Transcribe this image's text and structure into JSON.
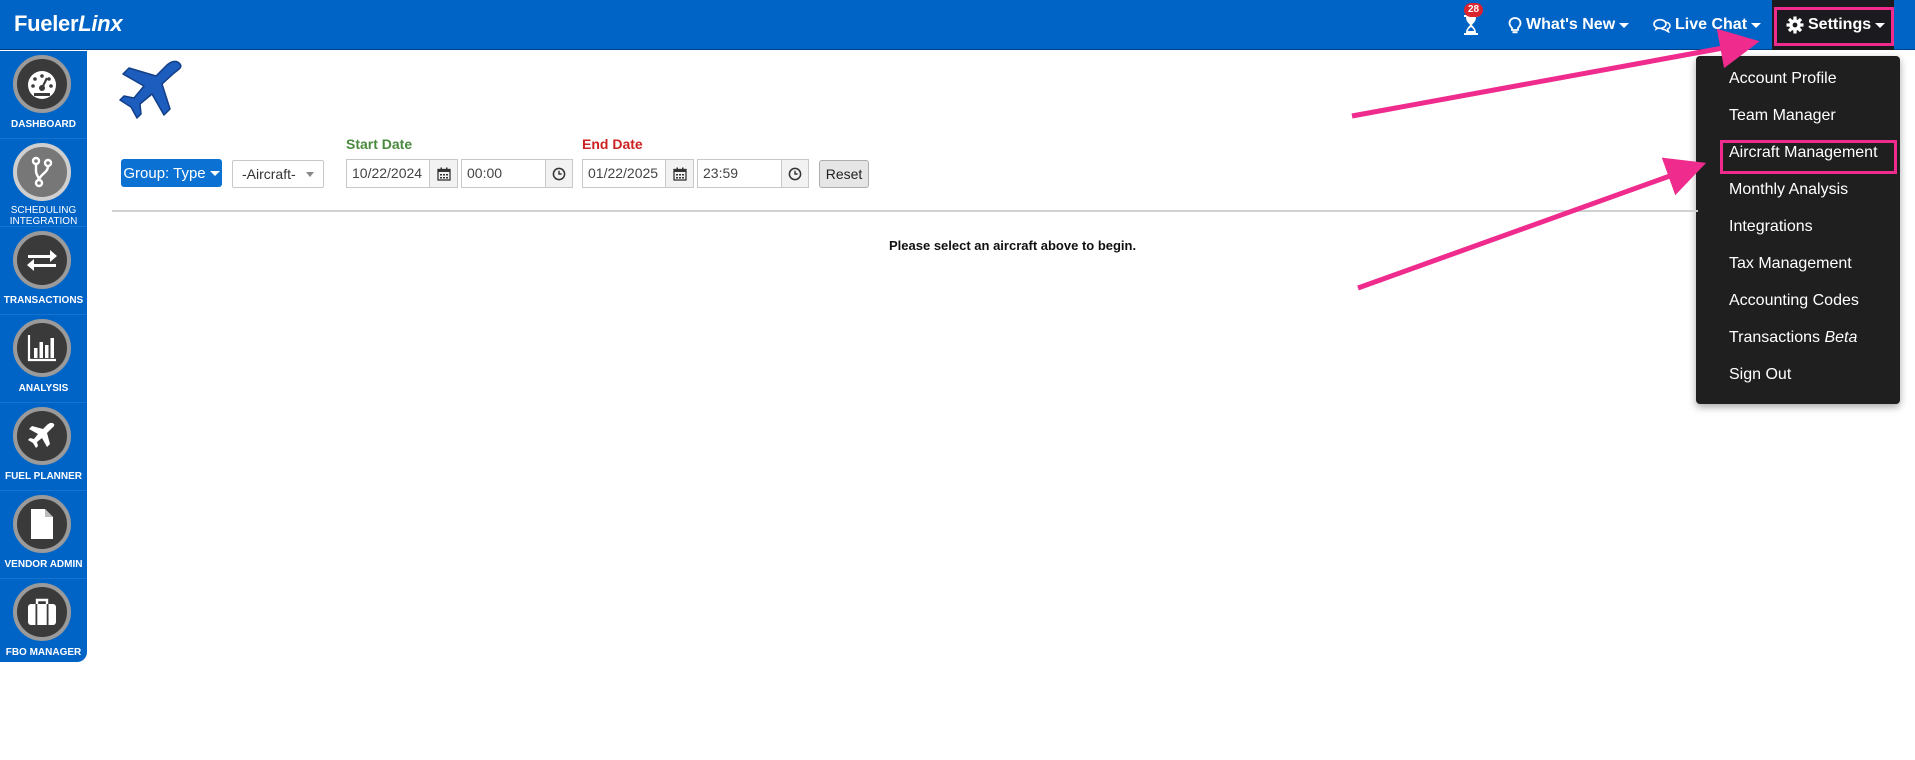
{
  "brand": {
    "logo_left": "Fueler",
    "logo_right": "Linx"
  },
  "header": {
    "notification_count": "28",
    "whats_new": "What's New",
    "live_chat": "Live Chat",
    "settings": "Settings"
  },
  "settings_menu": {
    "items": [
      {
        "label": "Account Profile"
      },
      {
        "label": "Team Manager"
      },
      {
        "label": "Aircraft Management"
      },
      {
        "label": "Monthly Analysis"
      },
      {
        "label": "Integrations"
      },
      {
        "label": "Tax Management"
      },
      {
        "label": "Accounting Codes"
      },
      {
        "label": "Transactions",
        "suffix": "Beta"
      },
      {
        "label": "Sign Out"
      }
    ]
  },
  "sidebar": {
    "items": [
      {
        "label": "DASHBOARD",
        "icon": "dashboard-gauge-icon"
      },
      {
        "label": "SCHEDULING INTEGRATION",
        "icon": "branch-icon"
      },
      {
        "label": "TRANSACTIONS",
        "icon": "transfer-arrows-icon"
      },
      {
        "label": "ANALYSIS",
        "icon": "bar-chart-icon"
      },
      {
        "label": "FUEL PLANNER",
        "icon": "airplane-icon"
      },
      {
        "label": "VENDOR ADMIN",
        "icon": "document-icon"
      },
      {
        "label": "FBO MANAGER",
        "icon": "briefcase-icon"
      }
    ]
  },
  "filters": {
    "group_button": "Group: Type",
    "aircraft_select": "-Aircraft-",
    "start_date_label": "Start Date",
    "start_date": "10/22/2024",
    "start_time": "00:00",
    "end_date_label": "End Date",
    "end_date": "01/22/2025",
    "end_time": "23:59",
    "reset": "Reset"
  },
  "main": {
    "message": "Please select an aircraft above to begin."
  },
  "colors": {
    "brand_blue": "#0063c6",
    "menu_bg": "#1f1f1f",
    "highlight_pink": "#ef2b8d",
    "start_label_green": "#4a8a3e",
    "end_label_red": "#cc2222"
  }
}
